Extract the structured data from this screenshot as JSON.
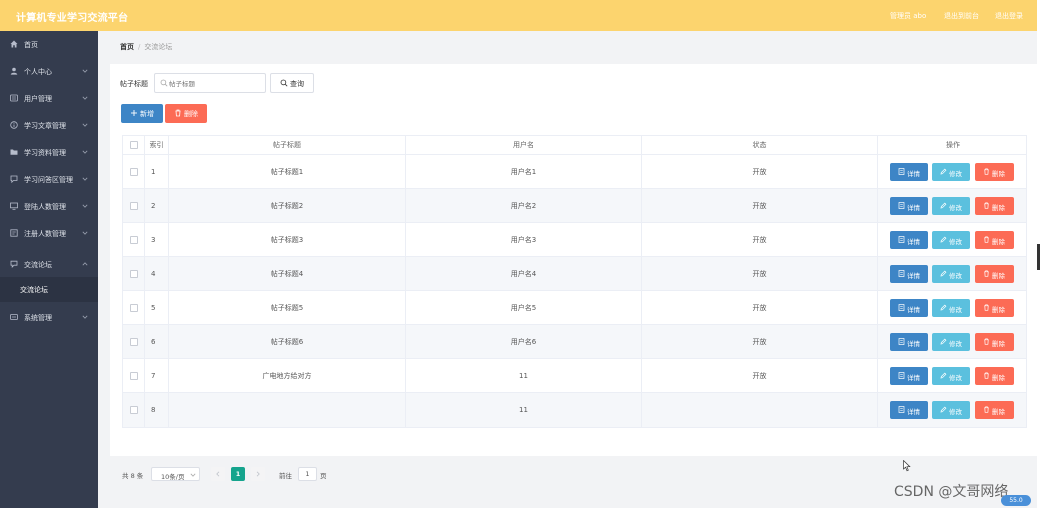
{
  "header": {
    "title": "计算机专业学习交流平台",
    "admin": "管理员 abo",
    "back_to_front": "退出到前台",
    "logout": "退出登录"
  },
  "sidebar": {
    "items": [
      {
        "label": "首页",
        "icon": "home-icon"
      },
      {
        "label": "个人中心",
        "icon": "user-icon"
      },
      {
        "label": "用户管理",
        "icon": "list-icon"
      },
      {
        "label": "学习文章管理",
        "icon": "info-icon"
      },
      {
        "label": "学习资料管理",
        "icon": "folder-icon"
      },
      {
        "label": "学习问答区管理",
        "icon": "question-icon"
      },
      {
        "label": "登陆人数管理",
        "icon": "monitor-icon"
      },
      {
        "label": "注册人数管理",
        "icon": "register-icon"
      },
      {
        "label": "交流论坛",
        "icon": "forum-icon"
      },
      {
        "label": "系统管理",
        "icon": "settings-icon"
      }
    ],
    "sub_item": "交流论坛"
  },
  "breadcrumb": {
    "home": "首页",
    "separator": "/",
    "current": "交流论坛"
  },
  "search": {
    "label": "帖子标题",
    "placeholder": "帖子标题",
    "button": "查询"
  },
  "actions": {
    "add": "新增",
    "delete": "删除"
  },
  "table": {
    "columns": [
      "索引",
      "帖子标题",
      "用户名",
      "状态",
      "操作"
    ],
    "rows": [
      {
        "index": "1",
        "title": "帖子标题1",
        "user": "用户名1",
        "status": "开放"
      },
      {
        "index": "2",
        "title": "帖子标题2",
        "user": "用户名2",
        "status": "开放"
      },
      {
        "index": "3",
        "title": "帖子标题3",
        "user": "用户名3",
        "status": "开放"
      },
      {
        "index": "4",
        "title": "帖子标题4",
        "user": "用户名4",
        "status": "开放"
      },
      {
        "index": "5",
        "title": "帖子标题5",
        "user": "用户名5",
        "status": "开放"
      },
      {
        "index": "6",
        "title": "帖子标题6",
        "user": "用户名6",
        "status": "开放"
      },
      {
        "index": "7",
        "title": "广电地方给对方",
        "user": "11",
        "status": "开放"
      },
      {
        "index": "8",
        "title": "",
        "user": "11",
        "status": ""
      }
    ],
    "ops": {
      "detail": "详情",
      "edit": "修改",
      "delete": "删除"
    }
  },
  "pagination": {
    "total": "共 8 条",
    "page_size": "10条/页",
    "current_page": "1",
    "goto_label": "前往",
    "goto_value": "1",
    "goto_unit": "页"
  },
  "watermark": "CSDN @文哥网络",
  "badge": "55.0",
  "colors": {
    "header": "#fcd46e",
    "sidebar": "#343c4e",
    "primary": "#3d85c6",
    "info": "#5bc0de",
    "danger": "#fc6b55",
    "pager_active": "#15a48d"
  }
}
